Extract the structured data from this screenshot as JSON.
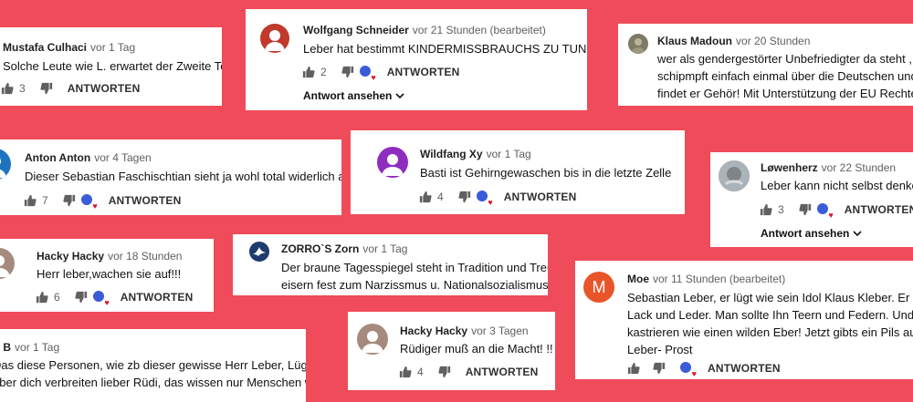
{
  "labels": {
    "reply": "ANTWORTEN",
    "view_replies": "Antwort ansehen"
  },
  "colors": {
    "background": "#f04b5a",
    "card": "#ffffff",
    "heart": "#e0102c"
  },
  "comments": [
    {
      "author": "Mustafa Culhaci",
      "time": "vor 1 Tag",
      "text": [
        "Solche Leute wie L. erwartet der Zweite Tod."
      ],
      "likes": "3"
    },
    {
      "author": "Wolfgang Schneider",
      "time": "vor 21 Stunden (bearbeitet)",
      "text": [
        "Leber hat bestimmt KINDERMISSBRAUCHS ZU TUN !!!🙂"
      ],
      "likes": "2",
      "avatar_letter": ""
    },
    {
      "author": "Klaus Madoun",
      "time": "vor 20 Stunden",
      "text": [
        "wer als gendergestörter Unbefriedigter da steht ,",
        "schipmpft einfach einmal über die Deutschen und sc",
        "findet er Gehör! Mit Unterstützung der EU Rechte !"
      ]
    },
    {
      "author": "Anton Anton",
      "time": "vor 4 Tagen",
      "text": [
        "Dieser Sebastian Faschischtian sieht ja wohl total widerlich aus."
      ],
      "likes": "7"
    },
    {
      "author": "Wildfang Xy",
      "time": "vor 1 Tag",
      "text": [
        "Basti ist Gehirngewaschen bis in  die letzte Zelle"
      ],
      "likes": "4"
    },
    {
      "author": "Løwenherz",
      "time": "vor 22 Stunden",
      "text": [
        "Leber kann nicht selbst denken"
      ],
      "likes": "3"
    },
    {
      "author": "Hacky Hacky",
      "time": "vor 18 Stunden",
      "text": [
        "Herr leber,wachen sie auf!!!"
      ],
      "likes": "6"
    },
    {
      "author": "ZORRO`S Zorn",
      "time": "vor 1 Tag",
      "text": [
        "Der braune Tagesspiegel steht in Tradition und Treue",
        "eisern fest zum Narzissmus u. Nationalsozialismus."
      ]
    },
    {
      "author": "Moe",
      "time": "vor 11 Stunden (bearbeitet)",
      "text": [
        "Sebastian Leber, er lügt wie sein Idol Klaus Kleber. Er steht a",
        "Lack und Leder. Man sollte Ihn Teern und Federn. Und",
        "kastrieren wie einen wilden Eber! Jetzt gibts ein Pils auf sei",
        "Leber- Prost"
      ],
      "avatar_letter": "M"
    },
    {
      "author": "S B",
      "time": "vor 1 Tag",
      "text": [
        "Das diese Personen, wie zb dieser gewisse Herr Leber, Lügen",
        "über dich verbreiten lieber Rüdi, das wissen nur Menschen wie"
      ]
    },
    {
      "author": "Hacky Hacky",
      "time": "vor 3 Tagen",
      "text": [
        "Rüdiger muß an die Macht! !!"
      ],
      "likes": "4"
    }
  ]
}
